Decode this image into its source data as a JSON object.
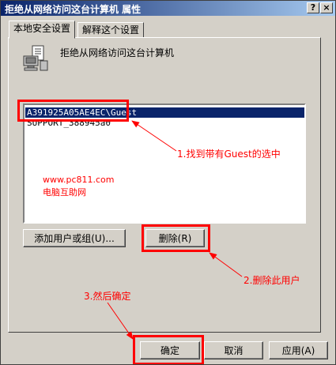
{
  "window": {
    "title": "拒绝从网络访问这台计算机 属性",
    "help_glyph": "?",
    "close_glyph": "×"
  },
  "tabs": [
    {
      "label": "本地安全设置",
      "active": true
    },
    {
      "label": "解释这个设置",
      "active": false
    }
  ],
  "policy": {
    "icon": "policy-document-icon",
    "heading": "拒绝从网络访问这台计算机"
  },
  "list": {
    "items": [
      {
        "label": "A391925A05AE4EC\\Guest",
        "selected": true
      },
      {
        "label": "SUPPORT_388945a0",
        "selected": false
      }
    ]
  },
  "buttons": {
    "add": "添加用户或组(U)...",
    "remove": "删除(R)",
    "ok": "确定",
    "cancel": "取消",
    "apply": "应用(A)"
  },
  "annotations": {
    "step1": "1.找到带有Guest的选中",
    "step2": "2.删除此用户",
    "step3": "3.然后确定",
    "watermark_url": "www.pc811.com",
    "watermark_name": "电脑互助网",
    "color": "#ff0000"
  },
  "colors": {
    "titlebar_start": "#0a246a",
    "titlebar_end": "#a6caf0",
    "face": "#d4d0c8",
    "selection": "#0a246a"
  }
}
